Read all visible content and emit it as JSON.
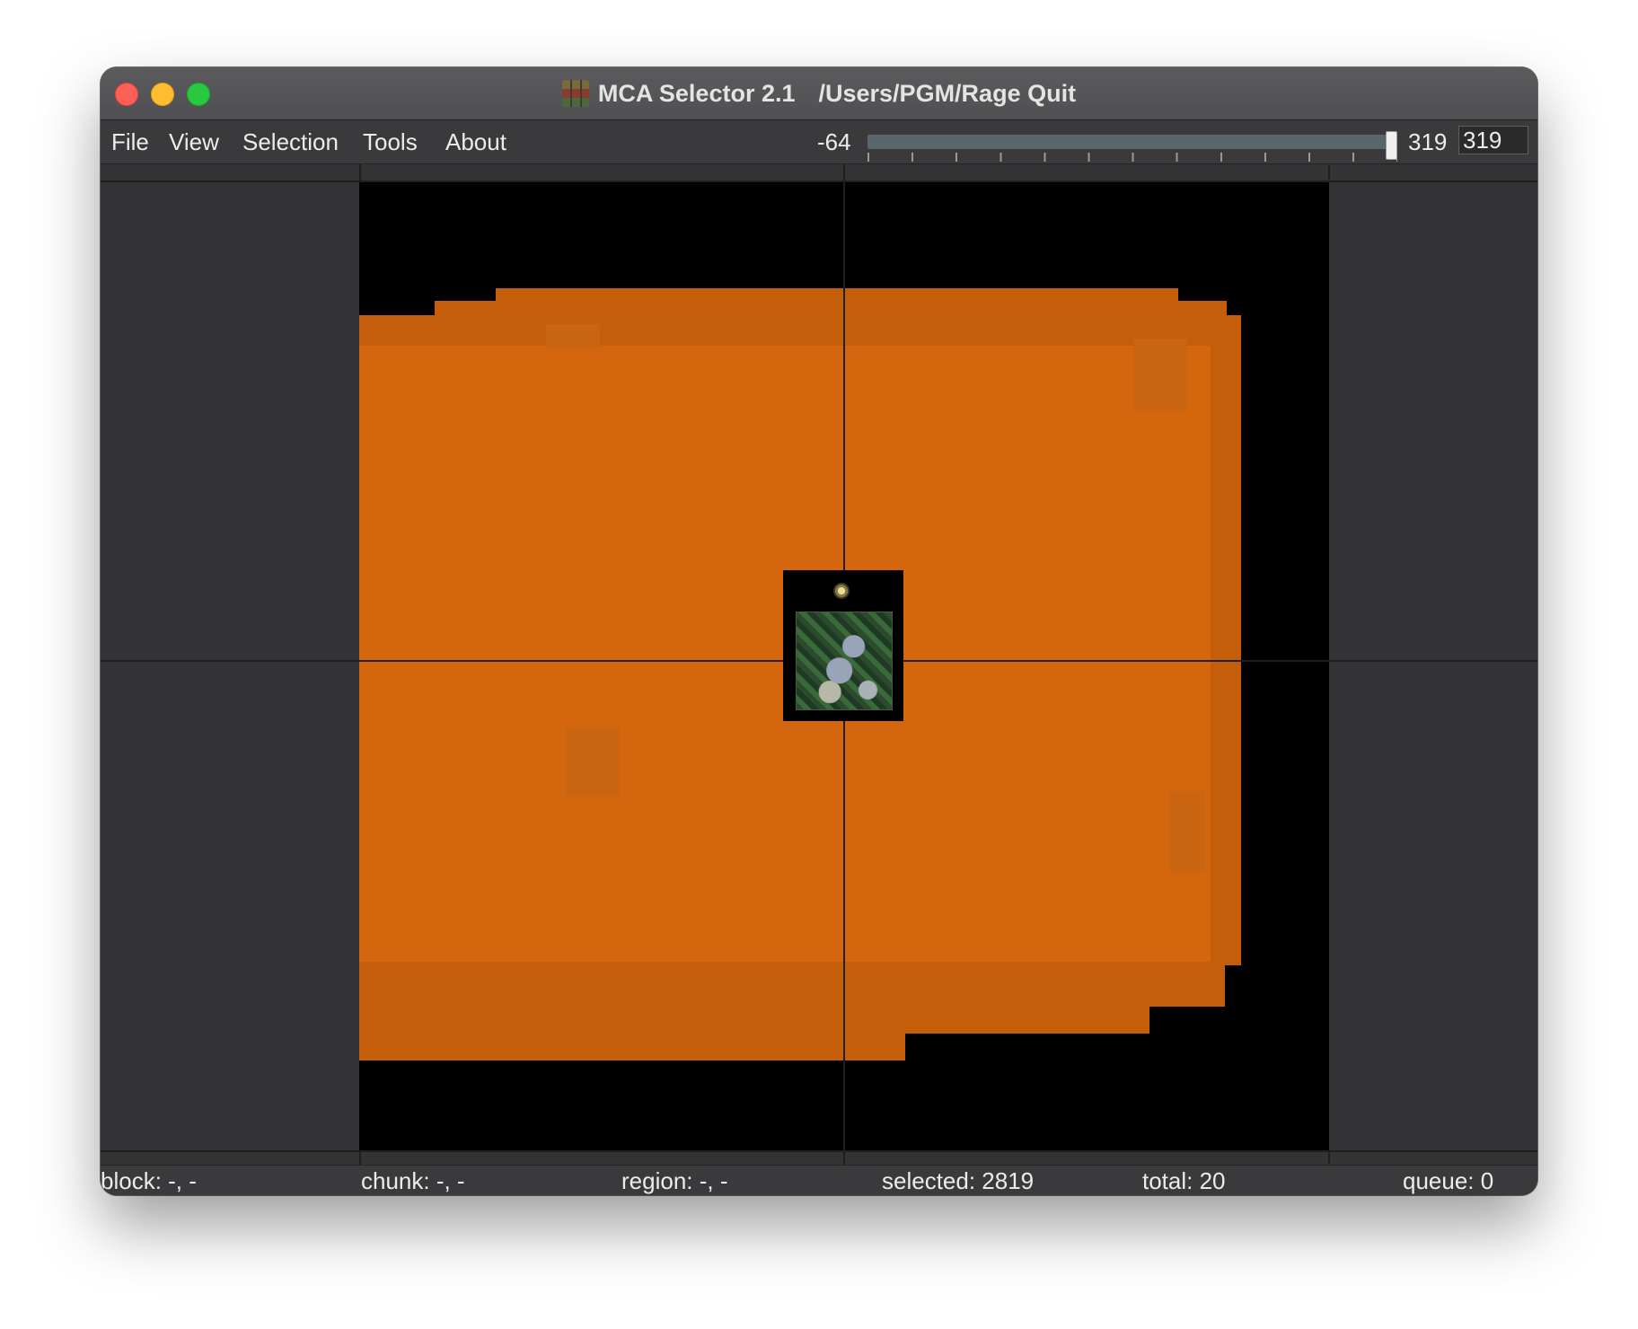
{
  "window": {
    "title": "MCA Selector 2.1",
    "path": "/Users/PGM/Rage Quit",
    "app_icon": "mca-selector-app-icon"
  },
  "menu": {
    "items": [
      {
        "label": "File"
      },
      {
        "label": "View"
      },
      {
        "label": "Selection"
      },
      {
        "label": "Tools"
      },
      {
        "label": "About"
      }
    ]
  },
  "height_slider": {
    "min_label": "-64",
    "max_label": "319",
    "value": 319,
    "fraction": 1.0,
    "input_value": "319"
  },
  "status": {
    "block": "block: -, -",
    "chunk": "chunk: -, -",
    "region": "region: -, -",
    "selected": "selected: 2819",
    "total": "total: 20",
    "queue": "queue: 0"
  },
  "colors": {
    "selection_overlay": "#d4670e",
    "background": "#333335",
    "void": "#000000"
  }
}
